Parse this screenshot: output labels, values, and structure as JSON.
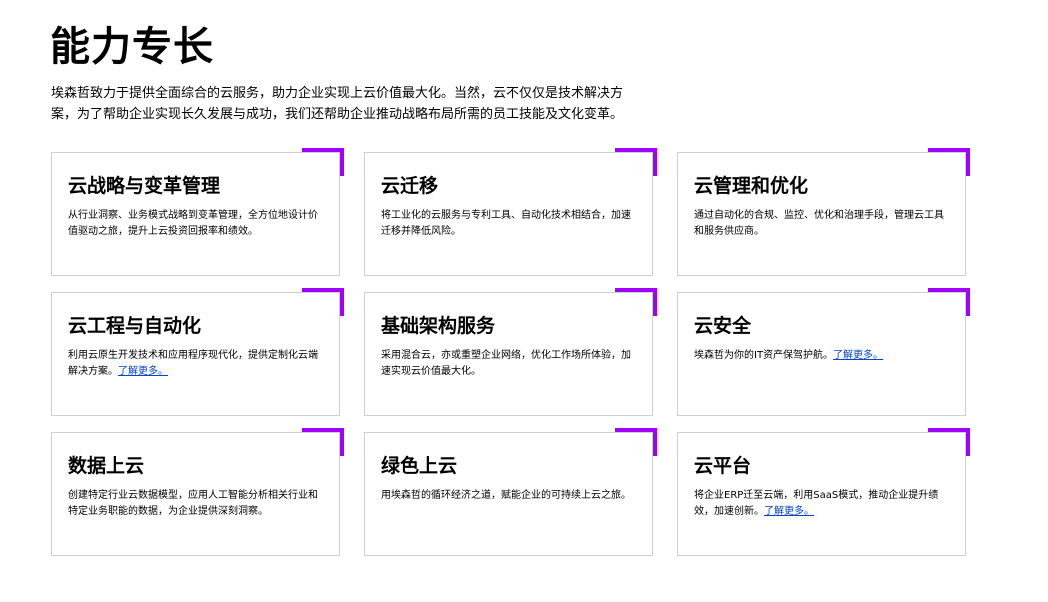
{
  "page": {
    "title": "能力专长",
    "intro": "埃森哲致力于提供全面综合的云服务，助力企业实现上云价值最大化。当然，云不仅仅是技术解决方案，为了帮助企业实现长久发展与成功，我们还帮助企业推动战略布局所需的员工技能及文化变革。"
  },
  "accent_color": "#a100ff",
  "link_color": "#0044cc",
  "cards": [
    {
      "title": "云战略与变革管理",
      "desc": "从行业洞察、业务模式战略到变革管理，全方位地设计价值驱动之旅，提升上云投资回报率和绩效。",
      "link": ""
    },
    {
      "title": "云迁移",
      "desc": "将工业化的云服务与专利工具、自动化技术相结合，加速迁移并降低风险。",
      "link": ""
    },
    {
      "title": "云管理和优化",
      "desc": "通过自动化的合规、监控、优化和治理手段，管理云工具和服务供应商。",
      "link": ""
    },
    {
      "title": "云工程与自动化",
      "desc": "利用云原生开发技术和应用程序现代化，提供定制化云端解决方案。",
      "link": "了解更多。"
    },
    {
      "title": "基础架构服务",
      "desc": "采用混合云，亦或重塑企业网络，优化工作场所体验，加速实现云价值最大化。",
      "link": ""
    },
    {
      "title": "云安全",
      "desc": "埃森哲为你的IT资产保驾护航。",
      "link": "了解更多。"
    },
    {
      "title": "数据上云",
      "desc": "创建特定行业云数据模型，应用人工智能分析相关行业和特定业务职能的数据，为企业提供深刻洞察。",
      "link": ""
    },
    {
      "title": "绿色上云",
      "desc": "用埃森哲的循环经济之道，赋能企业的可持续上云之旅。",
      "link": ""
    },
    {
      "title": "云平台",
      "desc": "将企业ERP迁至云端，利用SaaS模式，推动企业提升绩效，加速创新。",
      "link": "了解更多。"
    }
  ]
}
